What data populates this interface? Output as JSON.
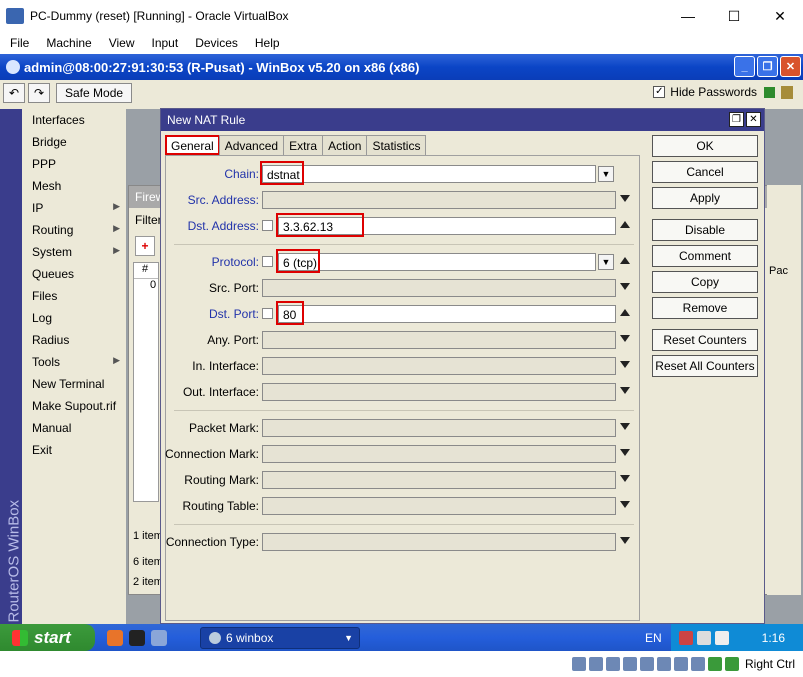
{
  "vbox": {
    "title": "PC-Dummy (reset) [Running] - Oracle VirtualBox",
    "menu": [
      "File",
      "Machine",
      "View",
      "Input",
      "Devices",
      "Help"
    ],
    "window_controls": {
      "minimize": "—",
      "maximize": "☐",
      "close": "✕"
    },
    "status": {
      "host_key": "Right Ctrl"
    }
  },
  "winbox": {
    "title": "admin@08:00:27:91:30:53 (R-Pusat) - WinBox v5.20 on x86 (x86)",
    "toolbar": {
      "undo": "↶",
      "redo": "↷",
      "safe_mode": "Safe Mode",
      "hide_passwords": "Hide Passwords",
      "hide_passwords_checked": true
    },
    "side_label": "RouterOS WinBox",
    "menu": [
      {
        "label": "Interfaces",
        "arrow": false
      },
      {
        "label": "Bridge",
        "arrow": false
      },
      {
        "label": "PPP",
        "arrow": false
      },
      {
        "label": "Mesh",
        "arrow": false
      },
      {
        "label": "IP",
        "arrow": true
      },
      {
        "label": "Routing",
        "arrow": true
      },
      {
        "label": "System",
        "arrow": true
      },
      {
        "label": "Queues",
        "arrow": false
      },
      {
        "label": "Files",
        "arrow": false
      },
      {
        "label": "Log",
        "arrow": false
      },
      {
        "label": "Radius",
        "arrow": false
      },
      {
        "label": "Tools",
        "arrow": true
      },
      {
        "label": "New Terminal",
        "arrow": false
      },
      {
        "label": "Make Supout.rif",
        "arrow": false
      },
      {
        "label": "Manual",
        "arrow": false
      },
      {
        "label": "Exit",
        "arrow": false
      }
    ],
    "background_window": {
      "title": "Firew",
      "filter_tab": "Filter",
      "add": "+",
      "col_hash": "#",
      "row_num": "0",
      "status1": "1 item",
      "status2": "6 item",
      "status3": "2 item",
      "right_frag_label": "Pac"
    }
  },
  "nat_rule": {
    "title": "New NAT Rule",
    "tabs": [
      "General",
      "Advanced",
      "Extra",
      "Action",
      "Statistics"
    ],
    "active_tab": "General",
    "fields": {
      "chain": {
        "label": "Chain:",
        "value": "dstnat"
      },
      "src_address": {
        "label": "Src. Address:",
        "value": ""
      },
      "dst_address": {
        "label": "Dst. Address:",
        "value": "3.3.62.13"
      },
      "protocol": {
        "label": "Protocol:",
        "value": "6 (tcp)"
      },
      "src_port": {
        "label": "Src. Port:",
        "value": ""
      },
      "dst_port": {
        "label": "Dst. Port:",
        "value": "80"
      },
      "any_port": {
        "label": "Any. Port:",
        "value": ""
      },
      "in_interface": {
        "label": "In. Interface:",
        "value": ""
      },
      "out_interface": {
        "label": "Out. Interface:",
        "value": ""
      },
      "packet_mark": {
        "label": "Packet Mark:",
        "value": ""
      },
      "connection_mark": {
        "label": "Connection Mark:",
        "value": ""
      },
      "routing_mark": {
        "label": "Routing Mark:",
        "value": ""
      },
      "routing_table": {
        "label": "Routing Table:",
        "value": ""
      },
      "connection_type": {
        "label": "Connection Type:",
        "value": ""
      }
    },
    "buttons": [
      "OK",
      "Cancel",
      "Apply",
      "Disable",
      "Comment",
      "Copy",
      "Remove",
      "Reset Counters",
      "Reset All Counters"
    ]
  },
  "taskbar": {
    "start": "start",
    "task": "6 winbox",
    "lang": "EN",
    "clock": "1:16"
  },
  "colors": {
    "xp_blue": "#245edb",
    "winbox_side": "#3a3d8c",
    "highlight_red": "#dd0000"
  }
}
